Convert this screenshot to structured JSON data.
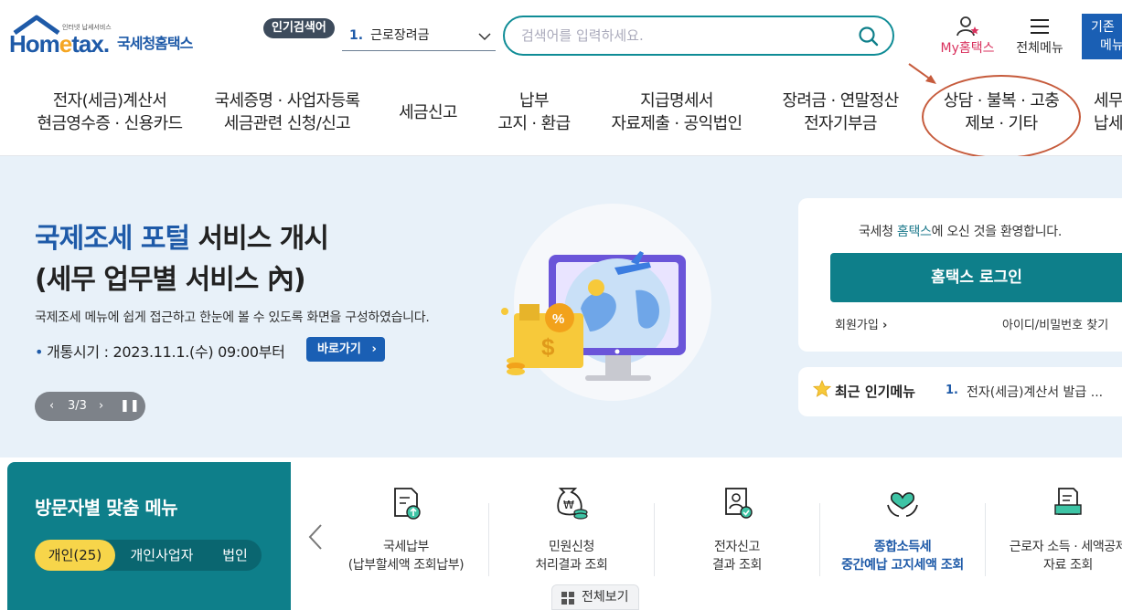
{
  "header": {
    "logo_tagline": "인터넷 납세서비스",
    "logo_brand_home": "Hom",
    "logo_brand_e": "e",
    "logo_brand_tax": "tax.",
    "logo_korean": "국세청홈택스",
    "popular_badge": "인기검색어",
    "popular_number": "1.",
    "popular_keyword": "근로장려금",
    "search_placeholder": "검색어를 입력하세요.",
    "my_prefix": "My",
    "my_suffix": "홈택스",
    "all_menu": "전체메뉴",
    "old_version_line1": "기존",
    "old_version_line2": "메뉴"
  },
  "nav": [
    {
      "line1": "전자(세금)계산서",
      "line2": "현금영수증 · 신용카드"
    },
    {
      "line1": "국세증명 · 사업자등록",
      "line2": "세금관련 신청/신고"
    },
    {
      "line1": "세금신고",
      "line2": ""
    },
    {
      "line1": "납부",
      "line2": "고지 · 환급"
    },
    {
      "line1": "지급명세서",
      "line2": "자료제출 · 공익법인"
    },
    {
      "line1": "장려금 · 연말정산",
      "line2": "전자기부금"
    },
    {
      "line1": "상담 · 불복 · 고충",
      "line2": "제보 · 기타"
    },
    {
      "line1": "세무",
      "line2": "납세"
    }
  ],
  "hero": {
    "title_highlight": "국제조세 포털",
    "title_rest": " 서비스 개시",
    "title_line2": "(세무 업무별 서비스 內)",
    "description": "국제조세 메뉴에 쉽게 접근하고 한눈에 볼 수 있도록 화면을 구성하였습니다.",
    "date_bullet": "•",
    "date_text": "개통시기 : 2023.11.1.(수) 09:00부터",
    "go_button": "바로가기",
    "pager_current": "3/3"
  },
  "login": {
    "welcome_prefix": "국세청 ",
    "welcome_highlight": "홈택스",
    "welcome_suffix": "에 오신 것을 환영합니다.",
    "login_button": "홈택스 로그인",
    "signup": "회원가입",
    "find_id_pw": "아이디/비밀번호 찾기"
  },
  "popular_menu": {
    "title": "최근 인기메뉴",
    "number": "1.",
    "item": "전자(세금)계산서 발급 ..."
  },
  "visitor": {
    "title": "방문자별 맞춤 메뉴",
    "tabs": [
      "개인(25)",
      "개인사업자",
      "법인"
    ]
  },
  "quick_menu": [
    {
      "line1": "국세납부",
      "line2": "(납부할세액 조회납부)",
      "icon": "tax-payment-icon"
    },
    {
      "line1": "민원신청",
      "line2": "처리결과 조회",
      "icon": "civil-request-icon"
    },
    {
      "line1": "전자신고",
      "line2": "결과 조회",
      "icon": "e-filing-icon"
    },
    {
      "line1": "종합소득세",
      "line2": "중간예납 고지세액 조회",
      "icon": "income-tax-icon"
    },
    {
      "line1": "근로자 소득 · 세액공제",
      "line2": "자료 조회",
      "icon": "worker-deduction-icon"
    }
  ],
  "view_all": "전체보기",
  "colors": {
    "brand_blue": "#1e5aa8",
    "teal": "#0e7f8a",
    "accent_yellow": "#f7d54a",
    "annotation_red": "#c65b3c"
  }
}
